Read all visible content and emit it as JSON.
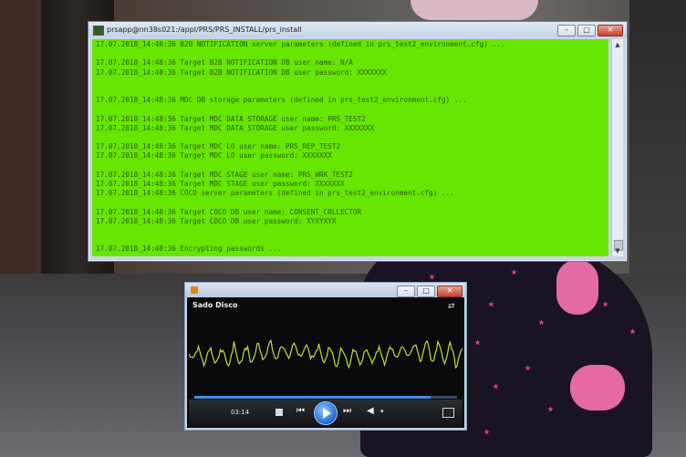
{
  "console": {
    "title": "prsapp@nn38s021:/appl/PRS/PRS_INSTALL/prs_install",
    "lines": [
      "17.07.2018_14:48:36 B2B NOTIFICATION server parameters (defined in prs_test2_environment.cfg) ...",
      "",
      "17.07.2018_14:48:36 Target B2B NOTIFICATION DB user name: N/A",
      "17.07.2018_14:48:36 Target B2B NOTIFICATION DB user password: XXXXXXX",
      "",
      "",
      "17.07.2018_14:48:36 MDC DB storage parameters (defined in prs_test2_environment.cfg) ...",
      "",
      "17.07.2018_14:48:36 Target MDC DATA STORAGE user name: PRS_TEST2",
      "17.07.2018_14:48:36 Target MDC DATA STORAGE user password: XXXXXXX",
      "",
      "17.07.2018_14:48:36 Target MDC LO user name: PRS_REP_TEST2",
      "17.07.2018_14:48:36 Target MDC LO user password: XXXXXXX",
      "",
      "17.07.2018_14:48:36 Target MDC STAGE user name: PRS_WRK_TEST2",
      "17.07.2018_14:48:36 Target MDC STAGE user password: XXXXXXX",
      "17.07.2018_14:48:36 COCO server parameters (defined in prs_test2_environment.cfg) ...",
      "",
      "17.07.2018_14:48:36 Target COCO DB user name: CONSENT_COLLECTOR",
      "17.07.2018_14:48:36 Target COCO DB user password: XYXYXYX",
      "",
      "",
      "17.07.2018_14:48:36 Encrypting passwords ..."
    ],
    "buttons": {
      "minimize": "–",
      "maximize": "□",
      "close": "✕"
    },
    "terminal_color": "#66e600"
  },
  "player": {
    "track": "Sado Disco",
    "time": "03:14",
    "progress_fraction": 0.9,
    "buttons": {
      "minimize": "–",
      "maximize": "□",
      "close": "✕"
    },
    "icons": [
      "switch-to-library-icon",
      "stop-icon",
      "previous-icon",
      "play-icon",
      "next-icon",
      "volume-icon",
      "volume-dropdown-icon",
      "now-playing-icon"
    ],
    "accent": "#3b8fe6",
    "wave_color": "#b7e23a"
  }
}
